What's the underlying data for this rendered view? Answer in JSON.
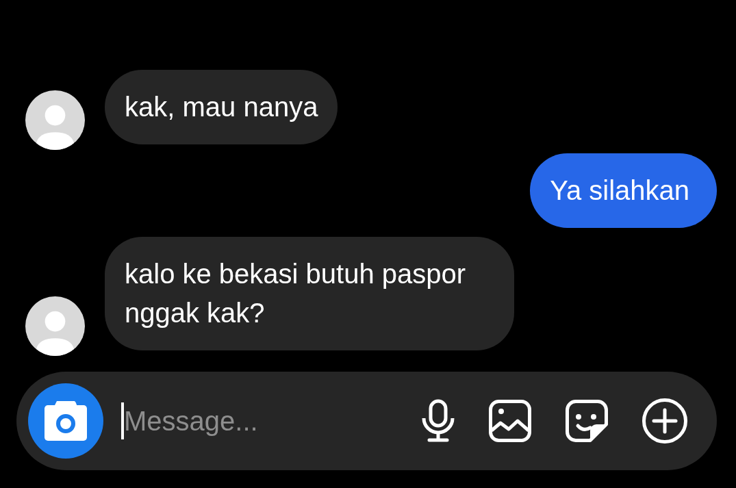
{
  "messages": [
    {
      "kind": "incoming",
      "text": "kak, mau nanya"
    },
    {
      "kind": "outgoing",
      "text": "Ya silahkan"
    },
    {
      "kind": "incoming",
      "text": "kalo ke bekasi butuh paspor nggak kak?"
    }
  ],
  "composer": {
    "placeholder": "Message...",
    "focused": true
  }
}
